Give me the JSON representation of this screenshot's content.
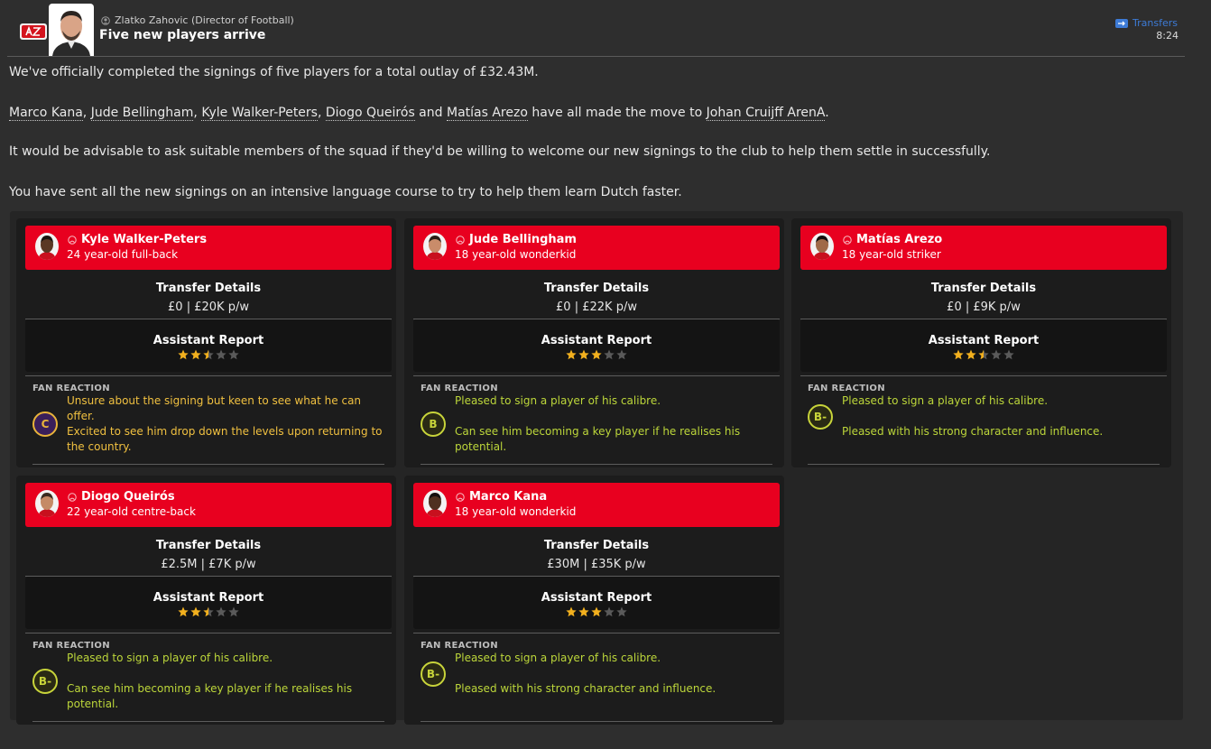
{
  "header": {
    "sender": "Zlatko Zahovic (Director of Football)",
    "subject": "Five new players arrive",
    "category": "Transfers",
    "time": "8:24"
  },
  "message": {
    "line1": "We've officially completed the signings of five players for a total outlay of £32.43M.",
    "line2_players": [
      "Marco Kana",
      "Jude Bellingham",
      "Kyle Walker-Peters",
      "Diogo Queirós",
      "Matías Arezo"
    ],
    "line2_sep1": ", ",
    "line2_and": " and ",
    "line2_mid": " have all made the move to ",
    "line2_stadium": "Johan Cruijff ArenA",
    "line2_end": ".",
    "line3": "It would be advisable to ask suitable members of the squad if they'd be willing to welcome our new signings to the club to help them settle in successfully.",
    "line4": "You have sent all the new signings on an intensive language course to try to help them learn Dutch faster."
  },
  "labels": {
    "transfer_details": "Transfer Details",
    "assistant_report": "Assistant Report",
    "fan_reaction": "FAN REACTION"
  },
  "players": [
    {
      "name": "Kyle Walker-Peters",
      "desc": "24 year-old full-back",
      "transfer": "£0 | £20K p/w",
      "stars": 2.5,
      "grade": "C",
      "reaction_color": "yellow",
      "reactions": [
        "Unsure about the signing but keen to see what he can offer.",
        "Excited to see him drop down the levels upon returning to the country."
      ]
    },
    {
      "name": "Jude Bellingham",
      "desc": "18 year-old wonderkid",
      "transfer": "£0 | £22K p/w",
      "stars": 3,
      "grade": "B",
      "reaction_color": "green",
      "reactions": [
        "Pleased to sign a player of his calibre.",
        "Can see him becoming a key player if he realises his potential."
      ]
    },
    {
      "name": "Matías Arezo",
      "desc": "18 year-old striker",
      "transfer": "£0 | £9K p/w",
      "stars": 2.5,
      "grade": "B-",
      "reaction_color": "green",
      "reactions": [
        "Pleased to sign a player of his calibre.",
        "Pleased with his strong character and influence."
      ]
    },
    {
      "name": "Diogo Queirós",
      "desc": "22 year-old centre-back",
      "transfer": "£2.5M | £7K p/w",
      "stars": 2.5,
      "grade": "B-",
      "reaction_color": "green",
      "reactions": [
        "Pleased to sign a player of his calibre.",
        "Can see him becoming a key player if he realises his potential."
      ]
    },
    {
      "name": "Marco Kana",
      "desc": "18 year-old wonderkid",
      "transfer": "£30M | £35K p/w",
      "stars": 3,
      "grade": "B-",
      "reaction_color": "green",
      "reactions": [
        "Pleased to sign a player of his calibre.",
        "Pleased with his strong character and influence."
      ]
    }
  ],
  "colors": {
    "accent_red": "#e8001f",
    "star_gold": "#f2b01e",
    "star_empty": "#5a5a5a",
    "link_blue": "#3d7bd6"
  }
}
